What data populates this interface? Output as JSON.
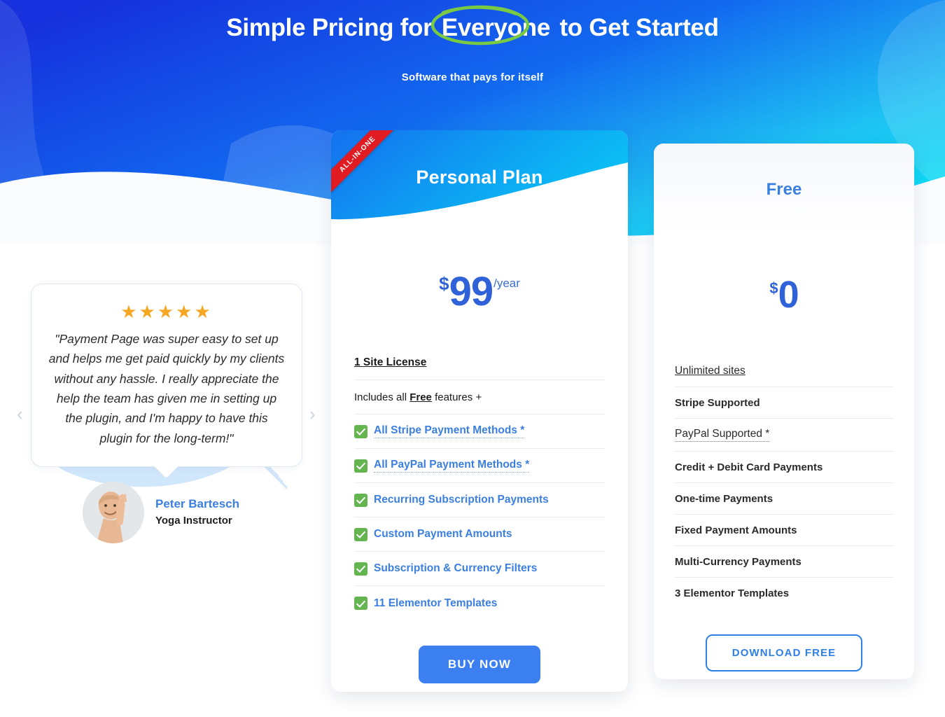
{
  "hero": {
    "title_before": "Simple Pricing for ",
    "title_circled": "Everyone",
    "title_after": " to Get Started",
    "subtitle": "Software that pays for itself",
    "gradient_start": "#1631dd",
    "gradient_end": "#08e3f5",
    "circle_color": "#7ac943"
  },
  "testimonial": {
    "stars": "★★★★★",
    "star_count": 5,
    "star_color": "#f5a623",
    "quote": "\"Payment Page was super easy to set up and helps me get paid quickly by my clients without any hassle. I really appreciate the help the team has given me in setting up the plugin, and I'm happy to have this plugin for the long-term!\"",
    "author_name": "Peter Bartesch",
    "author_role": "Yoga Instructor",
    "prev_arrow": "‹",
    "next_arrow": "›"
  },
  "personal_plan": {
    "ribbon": "ALL-IN-ONE",
    "title": "Personal Plan",
    "currency": "$",
    "amount": "99",
    "period": "/year",
    "license": "1 Site License",
    "includes_prefix": "Includes all ",
    "includes_link": "Free",
    "includes_suffix": " features +",
    "features": [
      {
        "label": "All Stripe Payment Methods *",
        "dotted": true
      },
      {
        "label": "All PayPal Payment Methods *",
        "dotted": true
      },
      {
        "label": "Recurring Subscription Payments",
        "dotted": false
      },
      {
        "label": "Custom Payment Amounts",
        "dotted": false
      },
      {
        "label": "Subscription & Currency Filters",
        "dotted": false
      },
      {
        "label": "11 Elementor Templates",
        "dotted": false
      }
    ],
    "cta": "BUY NOW",
    "accent": "#3b7ff0",
    "ribbon_color": "#e01b22",
    "check_color": "#64b450"
  },
  "free_plan": {
    "title": "Free",
    "currency": "$",
    "amount": "0",
    "items": [
      {
        "label": "Unlimited sites",
        "underline": "solid"
      },
      {
        "label": "Stripe Supported",
        "underline": "none"
      },
      {
        "label": "PayPal Supported *",
        "underline": "dotted"
      },
      {
        "label": "Credit + Debit Card Payments",
        "underline": "none"
      },
      {
        "label": "One-time Payments",
        "underline": "none"
      },
      {
        "label": "Fixed Payment Amounts",
        "underline": "none"
      },
      {
        "label": "Multi-Currency Payments",
        "underline": "none"
      },
      {
        "label": "3 Elementor Templates",
        "underline": "none"
      }
    ],
    "cta": "DOWNLOAD FREE",
    "accent": "#2f7fe8"
  }
}
